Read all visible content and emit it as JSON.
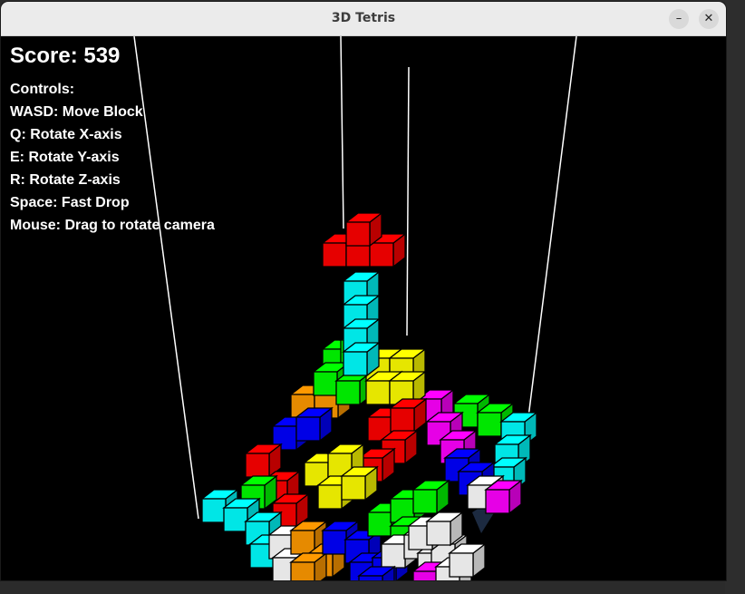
{
  "window": {
    "title": "3D Tetris",
    "minimize_glyph": "–",
    "close_glyph": "✕"
  },
  "hud": {
    "score_text": "Score: 539",
    "controls_title": "Controls:",
    "controls": [
      "WASD: Move Block",
      "Q: Rotate X-axis",
      "E: Rotate Y-axis",
      "R: Rotate Z-axis",
      "Space: Fast Drop",
      "Mouse: Drag to rotate camera"
    ]
  },
  "block_colors": {
    "red": "#ff0000",
    "cyan": "#00ffff",
    "green": "#00ff00",
    "yellow": "#ffff00",
    "blue": "#0000ff",
    "magenta": "#ff00ff",
    "orange": "#ff9900",
    "white": "#ffffff"
  }
}
